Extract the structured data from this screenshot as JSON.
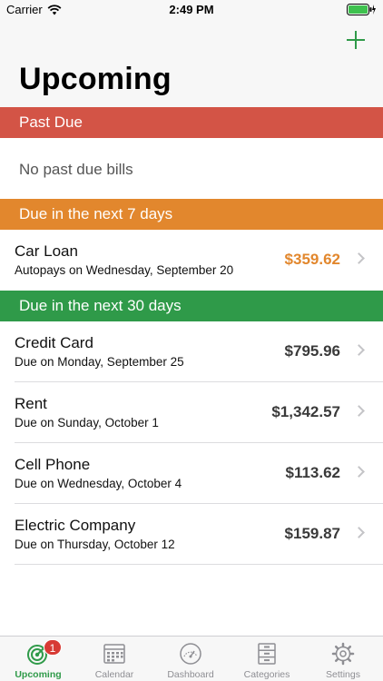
{
  "status_bar": {
    "carrier": "Carrier",
    "time": "2:49 PM",
    "wifi_icon": "wifi-icon",
    "battery_icon": "battery-charging-icon"
  },
  "nav": {
    "add_icon": "plus-icon",
    "title": "Upcoming"
  },
  "colors": {
    "past_due": "#d35446",
    "next_7": "#e2872d",
    "next_30": "#2f9a49",
    "accent": "#2f9a49"
  },
  "sections": {
    "past_due": {
      "title": "Past Due",
      "empty_text": "No past due bills"
    },
    "next_7": {
      "title": "Due in the next 7 days",
      "bills": [
        {
          "name": "Car Loan",
          "subtitle": "Autopays on Wednesday, September 20",
          "amount": "$359.62"
        }
      ]
    },
    "next_30": {
      "title": "Due in the next 30 days",
      "bills": [
        {
          "name": "Credit Card",
          "subtitle": "Due on Monday, September 25",
          "amount": "$795.96"
        },
        {
          "name": "Rent",
          "subtitle": "Due on Sunday, October 1",
          "amount": "$1,342.57"
        },
        {
          "name": "Cell Phone",
          "subtitle": "Due on Wednesday, October 4",
          "amount": "$113.62"
        },
        {
          "name": "Electric Company",
          "subtitle": "Due on Thursday, October 12",
          "amount": "$159.87"
        }
      ]
    }
  },
  "tab_bar": {
    "tabs": [
      {
        "label": "Upcoming",
        "icon": "target-icon",
        "badge": "1",
        "active": true
      },
      {
        "label": "Calendar",
        "icon": "calendar-icon"
      },
      {
        "label": "Dashboard",
        "icon": "gauge-icon"
      },
      {
        "label": "Categories",
        "icon": "cabinet-icon"
      },
      {
        "label": "Settings",
        "icon": "gear-icon"
      }
    ]
  }
}
